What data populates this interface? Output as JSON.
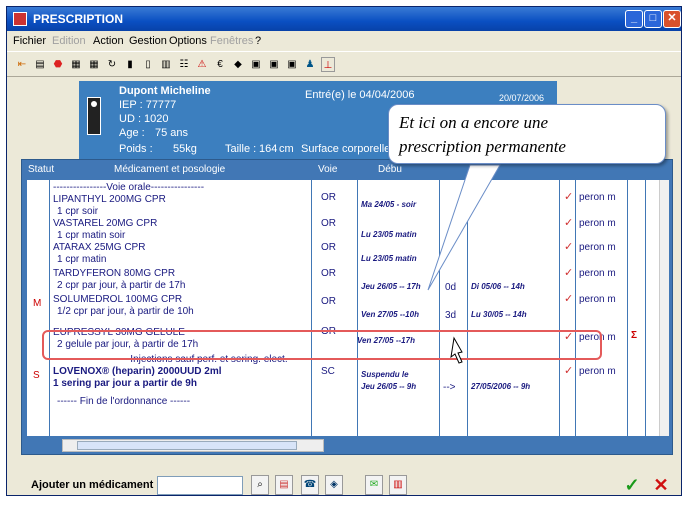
{
  "window": {
    "title": "PRESCRIPTION"
  },
  "menu": [
    {
      "label": "Fichier",
      "enabled": true
    },
    {
      "label": "Edition",
      "enabled": false
    },
    {
      "label": "Action",
      "enabled": true
    },
    {
      "label": "Gestion",
      "enabled": true
    },
    {
      "label": "Options",
      "enabled": true
    },
    {
      "label": "Fenêtres",
      "enabled": false
    },
    {
      "label": "?",
      "enabled": true
    }
  ],
  "patient": {
    "name": "Dupont Micheline",
    "iep": "IEP : 77777",
    "ud": "UD : 1020",
    "age_label": "Age :",
    "age": "75 ans",
    "poids_label": "Poids :",
    "poids": "55kg",
    "taille_label": "Taille :",
    "taille": "164",
    "taille_unit": "cm",
    "surface_label": "Surface corporelle :",
    "entree": "Entré(e) le 04/04/2006",
    "date": "20/07/2006"
  },
  "grid": {
    "headers": {
      "statut": "Statut",
      "medicament": "Médicament et posologie",
      "voie": "Voie",
      "debut": "Débu"
    },
    "rows": [
      {
        "lines": [
          "----------------Voie orale----------------"
        ]
      },
      {
        "lines": [
          "LIPANTHYL 200MG CPR",
          "1 cpr soir"
        ],
        "voie": "OR",
        "debut": "Ma 24/05 - soir",
        "user": "peron m",
        "checked": true
      },
      {
        "lines": [
          "VASTAREL 20MG CPR",
          "1 cpr matin soir"
        ],
        "voie": "OR",
        "debut": "Lu 23/05 matin",
        "user": "peron m",
        "checked": true
      },
      {
        "lines": [
          "ATARAX 25MG CPR",
          "1 cpr matin"
        ],
        "voie": "OR",
        "debut": "Lu 23/05 matin",
        "user": "peron m",
        "checked": true
      },
      {
        "lines": [
          "TARDYFERON 80MG CPR",
          "2 cpr par jour, à partir de 17h"
        ],
        "voie": "OR",
        "debut": "Jeu 26/05 -- 17h",
        "duree": "0d",
        "fin": "Di 05/06 -- 14h",
        "user": "peron m",
        "checked": true
      },
      {
        "status": "M",
        "lines": [
          "SOLUMEDROL 100MG CPR",
          "1/2 cpr par jour, à partir de 10h"
        ],
        "voie": "OR",
        "debut": "Ven 27/05 --10h",
        "duree": "3d",
        "fin": "Lu 30/05 -- 14h",
        "user": "peron m",
        "checked": true
      },
      {
        "lines": [
          "EUPRESSYL 30MG GELULE",
          "2 gelule par jour, à partir de 17h"
        ],
        "voie": "OR",
        "debut": "Ven 27/05 --17h",
        "user": "peron m",
        "checked": true,
        "flag": "Σ"
      },
      {
        "lines": [
          "-------------Injections sauf perf. et sering. elect.-------------"
        ]
      },
      {
        "status": "S",
        "lines": [
          "LOVENOX® (heparin) 2000UUD 2ml",
          "1 sering par jour a partir de 9h"
        ],
        "voie": "SC",
        "debut": "Suspendu le",
        "debut2": "Jeu 26/05 -- 9h",
        "duree": "-->",
        "fin": "27/05/2006 -- 9h",
        "user": "peron m",
        "checked": true
      },
      {
        "lines": [
          "------ Fin de l'ordonnance ------"
        ]
      }
    ]
  },
  "annotation": {
    "line1": "Et ici on a encore une",
    "line2": "prescription permanente"
  },
  "bottom": {
    "add_label": "Ajouter un médicament"
  },
  "colors": {
    "titlebar": "#0a4fc2",
    "patient_panel": "#3c7fbf",
    "grid_border": "#4177b5",
    "highlight": "#e45a5a",
    "check": "#d03030"
  }
}
